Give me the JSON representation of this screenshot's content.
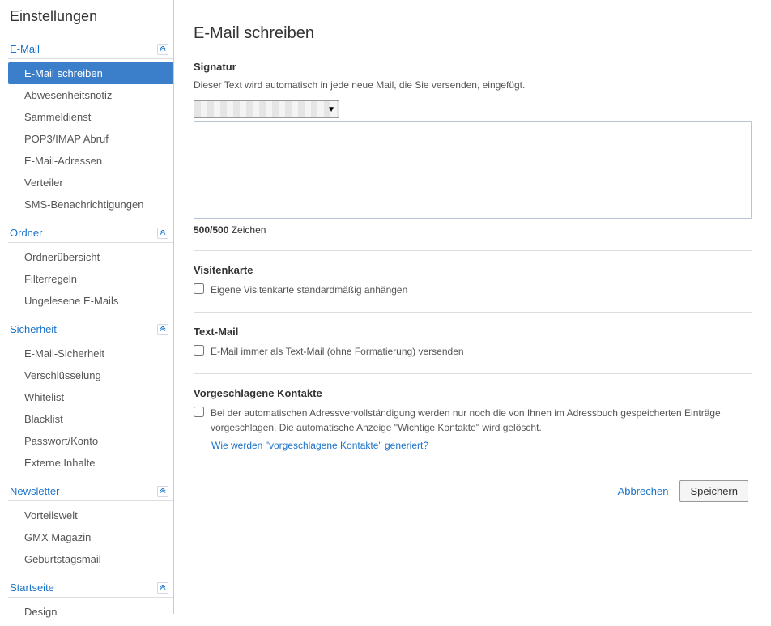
{
  "sidebar": {
    "title": "Einstellungen",
    "sections": [
      {
        "label": "E-Mail",
        "items": [
          {
            "label": "E-Mail schreiben",
            "active": true
          },
          {
            "label": "Abwesenheitsnotiz"
          },
          {
            "label": "Sammeldienst"
          },
          {
            "label": "POP3/IMAP Abruf"
          },
          {
            "label": "E-Mail-Adressen"
          },
          {
            "label": "Verteiler"
          },
          {
            "label": "SMS-Benachrichtigungen"
          }
        ]
      },
      {
        "label": "Ordner",
        "items": [
          {
            "label": "Ordnerübersicht"
          },
          {
            "label": "Filterregeln"
          },
          {
            "label": "Ungelesene E-Mails"
          }
        ]
      },
      {
        "label": "Sicherheit",
        "items": [
          {
            "label": "E-Mail-Sicherheit"
          },
          {
            "label": "Verschlüsselung"
          },
          {
            "label": "Whitelist"
          },
          {
            "label": "Blacklist"
          },
          {
            "label": "Passwort/Konto"
          },
          {
            "label": "Externe Inhalte"
          }
        ]
      },
      {
        "label": "Newsletter",
        "items": [
          {
            "label": "Vorteilswelt"
          },
          {
            "label": "GMX Magazin"
          },
          {
            "label": "Geburtstagsmail"
          }
        ]
      },
      {
        "label": "Startseite",
        "items": [
          {
            "label": "Design"
          }
        ]
      }
    ]
  },
  "main": {
    "title": "E-Mail schreiben",
    "signature": {
      "heading": "Signatur",
      "desc": "Dieser Text wird automatisch in jede neue Mail, die Sie versenden, eingefügt.",
      "select_value": "",
      "textarea_value": "",
      "char_count_bold": "500/500",
      "char_count_text": " Zeichen"
    },
    "vcard": {
      "heading": "Visitenkarte",
      "checkbox_label": "Eigene Visitenkarte standardmäßig anhängen"
    },
    "textmail": {
      "heading": "Text-Mail",
      "checkbox_label": "E-Mail immer als Text-Mail (ohne Formatierung) versenden"
    },
    "contacts": {
      "heading": "Vorgeschlagene Kontakte",
      "checkbox_label": "Bei der automatischen Adressvervollständigung werden nur noch die von Ihnen im Adressbuch gespeicherten Einträge vorgeschlagen. Die automatische Anzeige \"Wichtige Kontakte\" wird gelöscht.",
      "hint_link": "Wie werden \"vorgeschlagene Kontakte\" generiert?"
    },
    "actions": {
      "cancel": "Abbrechen",
      "save": "Speichern"
    }
  }
}
